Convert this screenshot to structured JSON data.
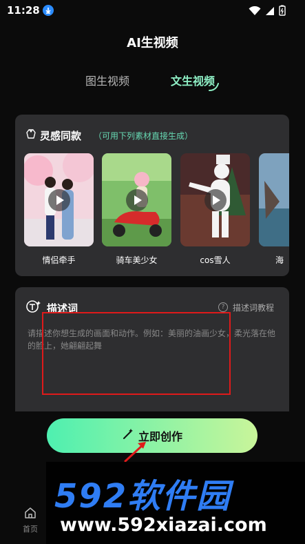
{
  "status_bar": {
    "time": "11:28"
  },
  "header": {
    "title": "AI生视频"
  },
  "tabs": [
    {
      "label": "图生视频",
      "active": false
    },
    {
      "label": "文生视频",
      "active": true
    }
  ],
  "inspiration": {
    "title": "灵感同款",
    "subtitle": "（可用下列素材直接生成）",
    "cards": [
      {
        "label": "情侣牵手"
      },
      {
        "label": "骑车美少女"
      },
      {
        "label": "cos雪人"
      },
      {
        "label": "海"
      }
    ]
  },
  "prompt": {
    "title": "描述词",
    "help_label": "描述词教程",
    "help_icon_glyph": "?",
    "placeholder": "请描述你想生成的画面和动作。例如：美丽的油画少女，柔光落在他的脸上，她翩翩起舞"
  },
  "create_button": {
    "label": "立即创作"
  },
  "bottom_nav": {
    "home_label": "首页"
  },
  "watermark": {
    "brand": "592软件园",
    "url": "www.592xiazai.com"
  },
  "colors": {
    "accent": "#8ff0c6",
    "subtitle": "#67d9b3",
    "button_gradient_start": "#4ef0b0",
    "button_gradient_end": "#c9f59a",
    "annotation_red": "#e01a1a",
    "watermark_blue": "#2f7df4"
  }
}
